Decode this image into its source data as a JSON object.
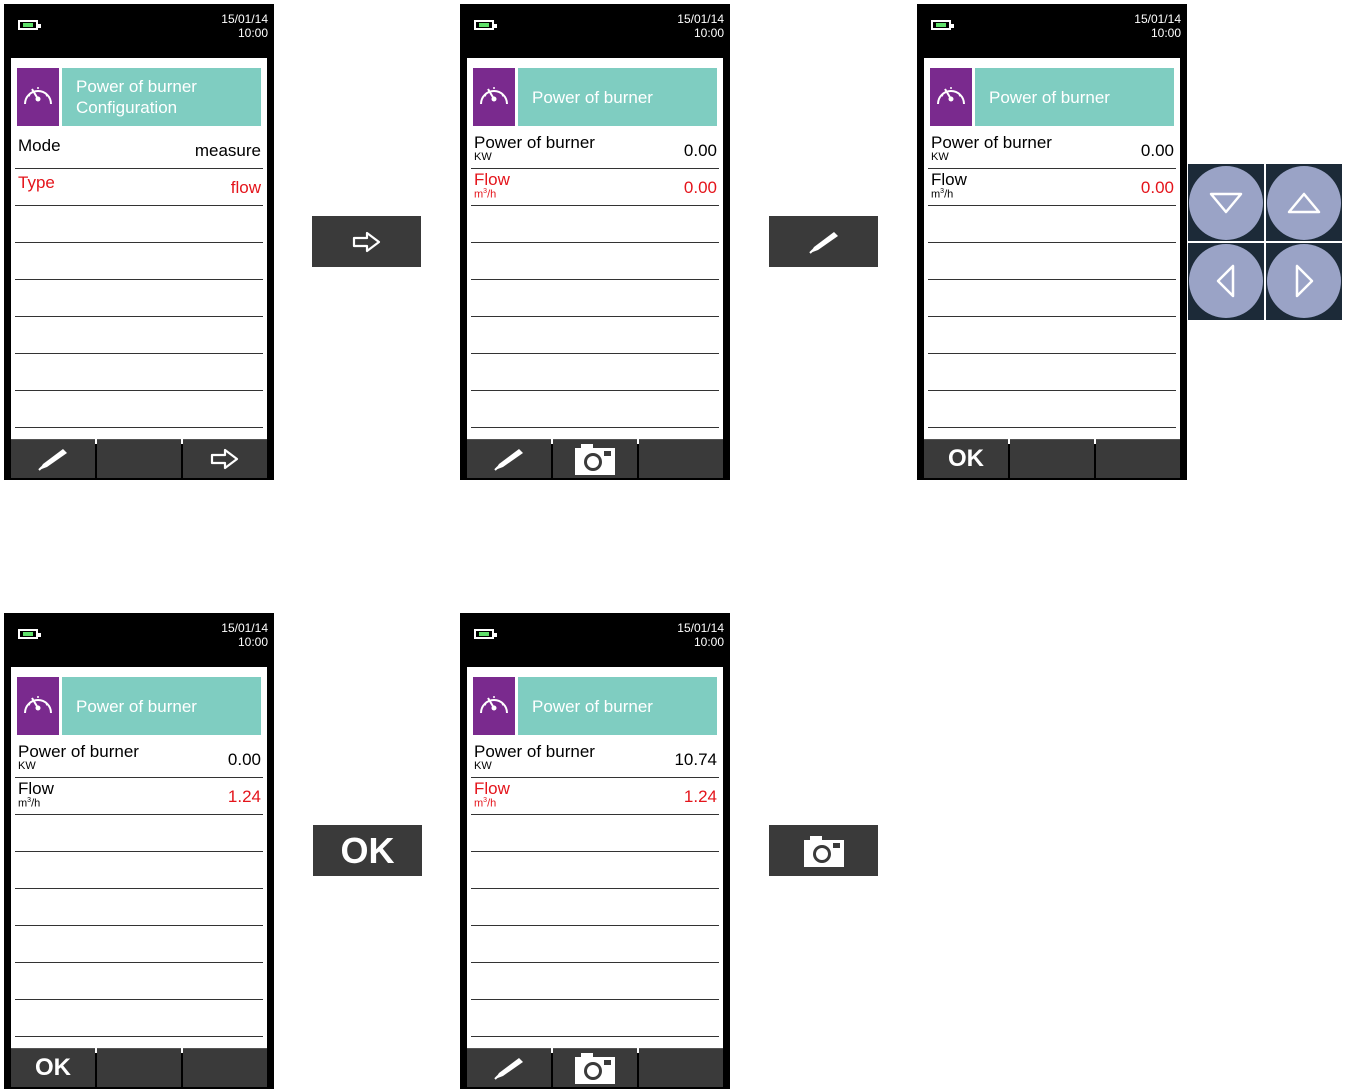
{
  "screens": [
    {
      "date": "15/01/14",
      "time": "10:00",
      "title_line1": "Power of burner",
      "title_line2": "Configuration",
      "rows": [
        {
          "label": "Mode",
          "value": "measure"
        },
        {
          "label": "Type",
          "value": "flow"
        }
      ],
      "softkeys": [
        "pencil-icon",
        "",
        "arrow-right-icon"
      ]
    },
    {
      "date": "15/01/14",
      "time": "10:00",
      "title_line1": "Power of burner",
      "rows": [
        {
          "label": "Power of burner",
          "unit": "KW",
          "value": "0.00"
        },
        {
          "label": "Flow",
          "unit_base": "m",
          "unit_sup": "3",
          "unit_tail": "/h",
          "value": "0.00"
        }
      ],
      "softkeys": [
        "pencil-icon",
        "camera-icon",
        ""
      ]
    },
    {
      "date": "15/01/14",
      "time": "10:00",
      "title_line1": "Power of burner",
      "rows": [
        {
          "label": "Power of burner",
          "unit": "KW",
          "value": "0.00"
        },
        {
          "label": "Flow",
          "unit_base": "m",
          "unit_sup": "3",
          "unit_tail": "/h",
          "value": "0.00"
        }
      ],
      "softkeys": [
        "OK",
        "",
        ""
      ]
    },
    {
      "date": "15/01/14",
      "time": "10:00",
      "title_line1": "Power of burner",
      "rows": [
        {
          "label": "Power of burner",
          "unit": "KW",
          "value": "0.00"
        },
        {
          "label": "Flow",
          "unit_base": "m",
          "unit_sup": "3",
          "unit_tail": "/h",
          "value": "1.24"
        }
      ],
      "softkeys": [
        "OK",
        "",
        ""
      ]
    },
    {
      "date": "15/01/14",
      "time": "10:00",
      "title_line1": "Power of burner",
      "rows": [
        {
          "label": "Power of burner",
          "unit": "KW",
          "value": "10.74"
        },
        {
          "label": "Flow",
          "unit_base": "m",
          "unit_sup": "3",
          "unit_tail": "/h",
          "value": "1.24"
        }
      ],
      "softkeys": [
        "pencil-icon",
        "camera-icon",
        ""
      ]
    }
  ],
  "step_keys": {
    "arrow_key": "arrow-right-icon",
    "pencil_key": "pencil-icon",
    "ok_key": "OK",
    "camera_key": "camera-icon"
  },
  "navpad": [
    "down-triangle-icon",
    "up-triangle-icon",
    "left-triangle-icon",
    "right-triangle-icon"
  ],
  "colors": {
    "device": "#000000",
    "header_teal": "#7fcdc1",
    "header_icon_purple": "#7a2a8e",
    "highlight_red": "#e4141b",
    "softkey_gray": "#3a3a3a",
    "navpad_bg": "#1c2a38",
    "navkey": "#9aa3c6"
  }
}
